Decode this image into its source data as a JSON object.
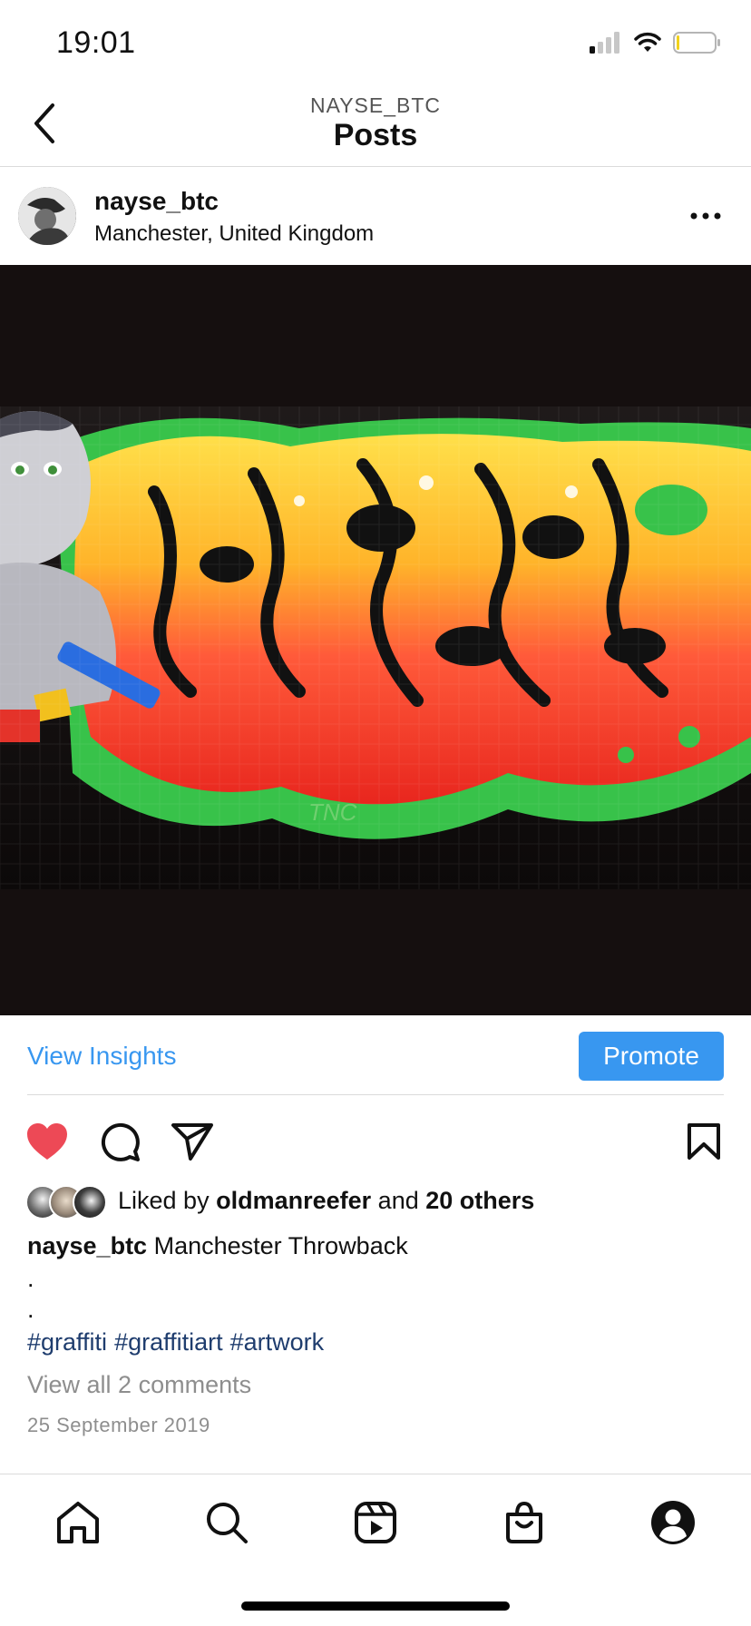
{
  "status_bar": {
    "time": "19:01",
    "icons": [
      "signal-icon",
      "wifi-icon",
      "battery-icon"
    ]
  },
  "header": {
    "account": "NAYSE_BTC",
    "title": "Posts",
    "back_icon": "chevron-left-icon"
  },
  "post": {
    "username": "nayse_btc",
    "location": "Manchester, United Kingdom",
    "more_icon": "more-horizontal-icon",
    "image_alt": "graffiti-artwork",
    "image_tag": "TNC"
  },
  "insights": {
    "view_label": "View Insights",
    "promote_label": "Promote"
  },
  "actions": {
    "like_icon": "heart-filled-icon",
    "comment_icon": "comment-icon",
    "share_icon": "send-icon",
    "save_icon": "bookmark-icon"
  },
  "likes": {
    "prefix": "Liked by",
    "first_liker": "oldmanreefer",
    "connector": "and",
    "others": "20 others"
  },
  "caption": {
    "username": "nayse_btc",
    "text": "Manchester Throwback",
    "dot1": ".",
    "dot2": ".",
    "hashtags": [
      "#graffiti",
      "#graffitiart",
      "#artwork"
    ]
  },
  "comments": {
    "view_all": "View all 2 comments"
  },
  "date": "25 September 2019",
  "bottom_nav": {
    "items": [
      "home-icon",
      "search-icon",
      "reels-icon",
      "shop-icon",
      "profile-icon"
    ]
  },
  "colors": {
    "accent": "#3897f0",
    "like": "#ed4956",
    "hashtag": "#1f3d6e",
    "muted": "#8e8e8e"
  }
}
